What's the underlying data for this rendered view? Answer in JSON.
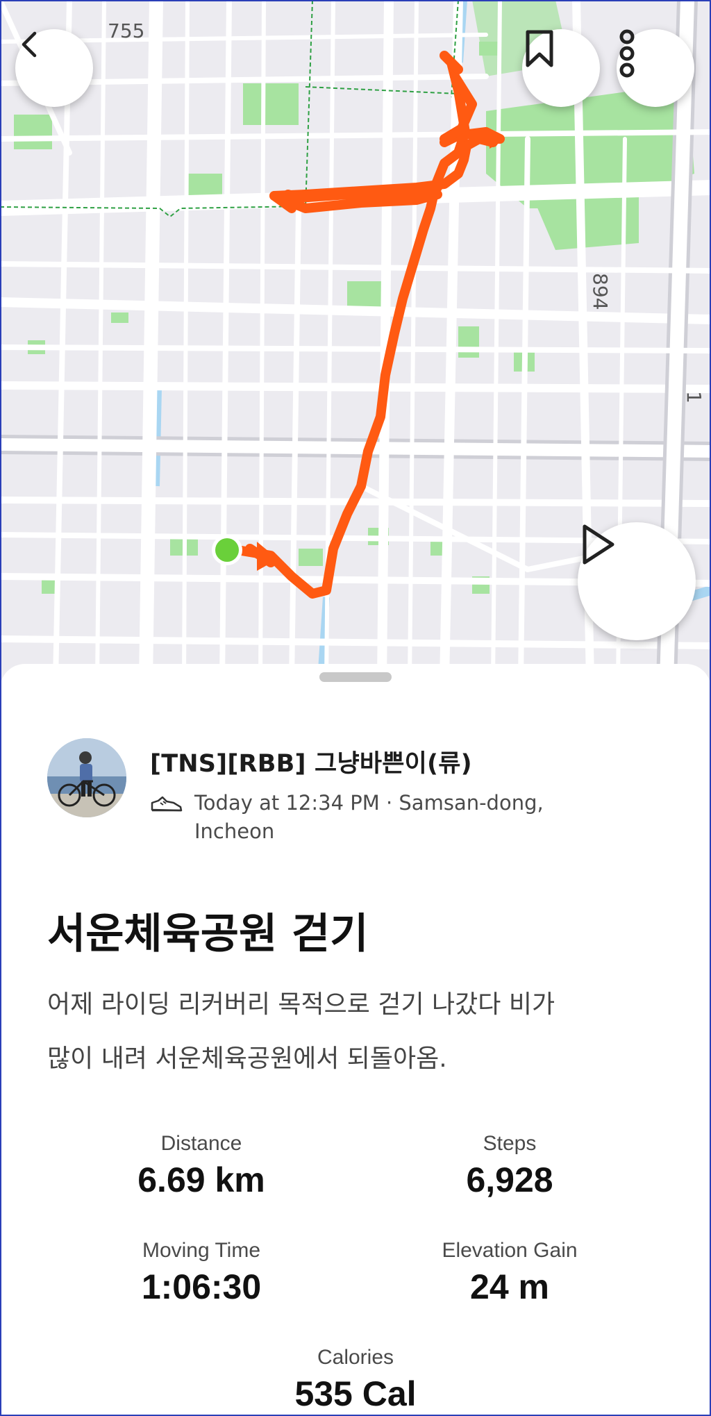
{
  "map": {
    "road_labels": [
      "755",
      "894",
      "1"
    ],
    "route_color": "#ff5a12",
    "start_marker_color": "#6ad03a",
    "park_color": "#a7e3a0",
    "water_color": "#a9d6f2"
  },
  "buttons": {
    "back_icon": "chevron-left-icon",
    "bookmark_icon": "bookmark-icon",
    "more_icon": "more-vertical-icon",
    "play_icon": "play-icon"
  },
  "activity": {
    "athlete_name": "[TNS][RBB] 그냥바쁜이(류)",
    "sport_icon": "shoe-icon",
    "meta_line1": "Today at 12:34 PM · Samsan-dong,",
    "meta_line2": "Incheon",
    "title": "서운체육공원 걷기",
    "description_line1": "어제 라이딩 리커버리 목적으로 걷기 나갔다 비가",
    "description_line2": "많이 내려 서운체육공원에서 되돌아옴."
  },
  "stats": {
    "distance": {
      "label": "Distance",
      "value": "6.69 km"
    },
    "steps": {
      "label": "Steps",
      "value": "6,928"
    },
    "moving_time": {
      "label": "Moving Time",
      "value": "1:06:30"
    },
    "elevation_gain": {
      "label": "Elevation Gain",
      "value": "24 m"
    },
    "calories": {
      "label": "Calories",
      "value": "535 Cal"
    }
  }
}
